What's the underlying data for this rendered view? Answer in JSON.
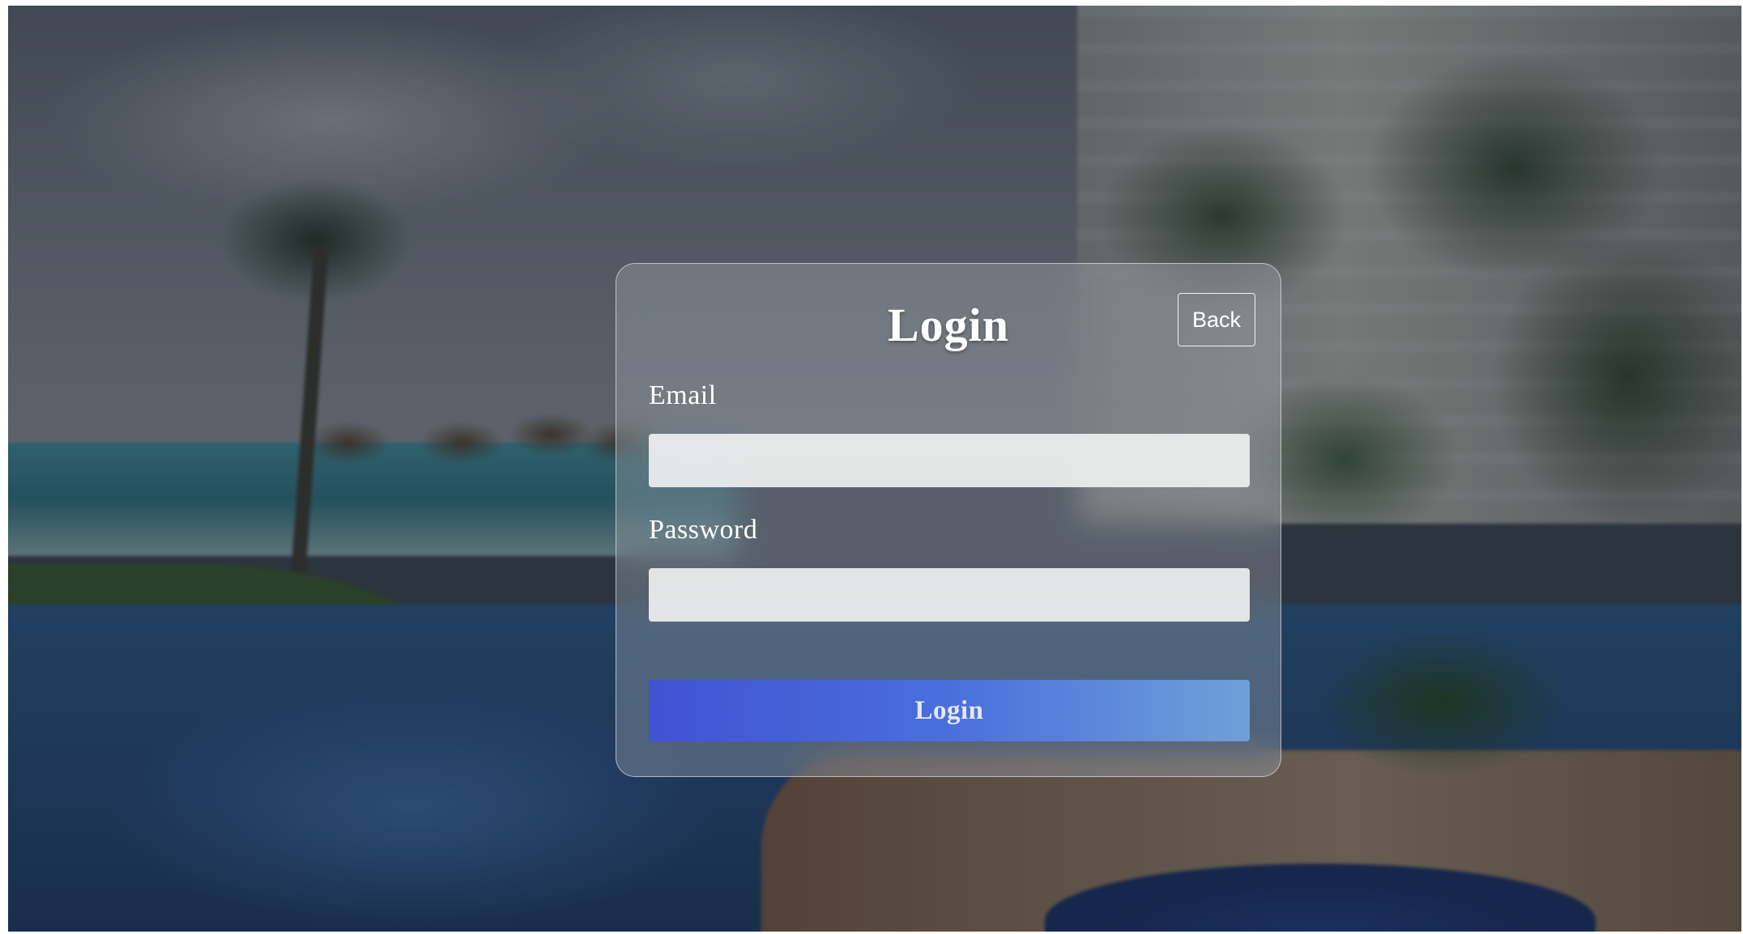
{
  "login_form": {
    "title": "Login",
    "back_label": "Back",
    "email_label": "Email",
    "email_value": "",
    "password_label": "Password",
    "password_value": "",
    "submit_label": "Login"
  },
  "colors": {
    "submit_gradient_start": "#4152d3",
    "submit_gradient_end": "#6fa0d8",
    "card_border": "#ffffff",
    "text": "#ffffff"
  }
}
